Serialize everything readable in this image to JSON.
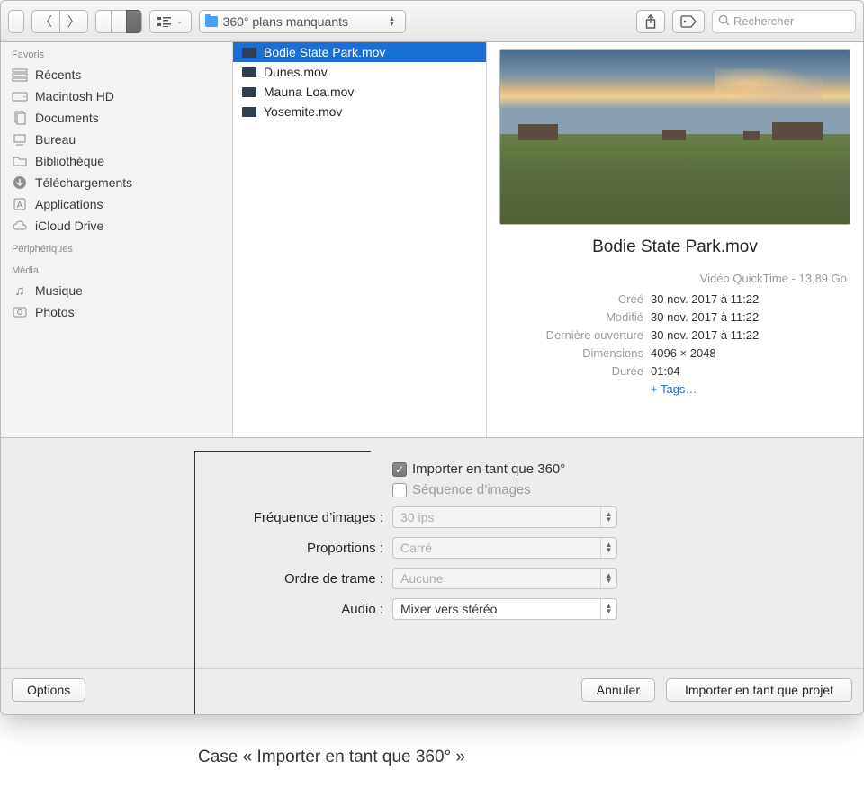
{
  "toolbar": {
    "path_label": "360° plans manquants",
    "search_placeholder": "Rechercher"
  },
  "sidebar": {
    "favorites_header": "Favoris",
    "devices_header": "Périphériques",
    "media_header": "Média",
    "items": [
      {
        "label": "Récents"
      },
      {
        "label": "Macintosh HD"
      },
      {
        "label": "Documents"
      },
      {
        "label": "Bureau"
      },
      {
        "label": "Bibliothèque"
      },
      {
        "label": "Téléchargements"
      },
      {
        "label": "Applications"
      },
      {
        "label": "iCloud Drive"
      }
    ],
    "media": [
      {
        "label": "Musique"
      },
      {
        "label": "Photos"
      }
    ]
  },
  "files": [
    {
      "name": "Bodie State Park.mov"
    },
    {
      "name": "Dunes.mov"
    },
    {
      "name": "Mauna Loa.mov"
    },
    {
      "name": "Yosemite.mov"
    }
  ],
  "preview": {
    "title": "Bodie State Park.mov",
    "kind": "Vidéo QuickTime - 13,89 Go",
    "created_k": "Créé",
    "created_v": "30 nov. 2017 à 11:22",
    "modified_k": "Modifié",
    "modified_v": "30 nov. 2017 à 11:22",
    "opened_k": "Dernière ouverture",
    "opened_v": "30 nov. 2017 à 11:22",
    "dim_k": "Dimensions",
    "dim_v": "4096 × 2048",
    "dur_k": "Durée",
    "dur_v": "01:04",
    "tags": "+ Tags…"
  },
  "options": {
    "import360": "Importer en tant que 360°",
    "sequence": "Séquence d’images",
    "framerate_l": "Fréquence d’images :",
    "framerate_v": "30 ips",
    "ratio_l": "Proportions :",
    "ratio_v": "Carré",
    "field_l": "Ordre de trame :",
    "field_v": "Aucune",
    "audio_l": "Audio :",
    "audio_v": "Mixer vers stéréo"
  },
  "buttons": {
    "options": "Options",
    "cancel": "Annuler",
    "import": "Importer en tant que projet"
  },
  "caption": "Case « Importer en tant que 360° »"
}
